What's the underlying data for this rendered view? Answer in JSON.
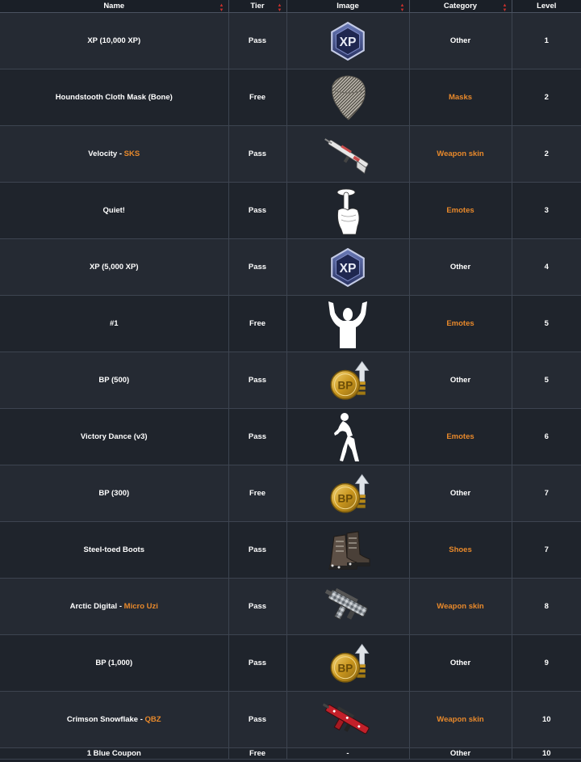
{
  "headers": {
    "name": "Name",
    "tier": "Tier",
    "image": "Image",
    "category": "Category",
    "level": "Level"
  },
  "rows": [
    {
      "name": "XP (10,000 XP)",
      "tier": "Pass",
      "icon": "xp-badge-icon",
      "category": "Other",
      "level": "1"
    },
    {
      "name": "Houndstooth Cloth Mask (Bone)",
      "tier": "Free",
      "icon": "mask-icon",
      "category": "Masks",
      "level": "2"
    },
    {
      "name": "Velocity",
      "name_sep": " - ",
      "name_weapon": "SKS",
      "tier": "Pass",
      "icon": "rifle-icon",
      "category": "Weapon skin",
      "level": "2"
    },
    {
      "name": "Quiet!",
      "tier": "Pass",
      "icon": "shush-hand-icon",
      "category": "Emotes",
      "level": "3"
    },
    {
      "name": "XP (5,000 XP)",
      "tier": "Pass",
      "icon": "xp-badge-icon",
      "category": "Other",
      "level": "4"
    },
    {
      "name": "#1",
      "tier": "Free",
      "icon": "arms-raised-figure-icon",
      "category": "Emotes",
      "level": "5"
    },
    {
      "name": "BP (500)",
      "tier": "Pass",
      "icon": "bp-coin-icon",
      "category": "Other",
      "level": "5"
    },
    {
      "name": "Victory Dance (v3)",
      "tier": "Pass",
      "icon": "dancing-figure-icon",
      "category": "Emotes",
      "level": "6"
    },
    {
      "name": "BP (300)",
      "tier": "Free",
      "icon": "bp-coin-icon",
      "category": "Other",
      "level": "7"
    },
    {
      "name": "Steel-toed Boots",
      "tier": "Pass",
      "icon": "boots-icon",
      "category": "Shoes",
      "level": "7"
    },
    {
      "name": "Arctic Digital",
      "name_sep": " - ",
      "name_weapon": "Micro Uzi",
      "tier": "Pass",
      "icon": "smg-icon",
      "category": "Weapon skin",
      "level": "8"
    },
    {
      "name": "BP (1,000)",
      "tier": "Pass",
      "icon": "bp-coin-icon",
      "category": "Other",
      "level": "9"
    },
    {
      "name": "Crimson Snowflake",
      "name_sep": " - ",
      "name_weapon": "QBZ",
      "tier": "Pass",
      "icon": "red-rifle-icon",
      "category": "Weapon skin",
      "level": "10"
    },
    {
      "name": "1 Blue Coupon",
      "tier": "Free",
      "image_text": "-",
      "category": "Other",
      "level": "10"
    }
  ],
  "colors": {
    "orange": "#e8892b",
    "row_odd": "#252a33",
    "row_even": "#1f242c",
    "sort_arrow": "#c9302c"
  }
}
